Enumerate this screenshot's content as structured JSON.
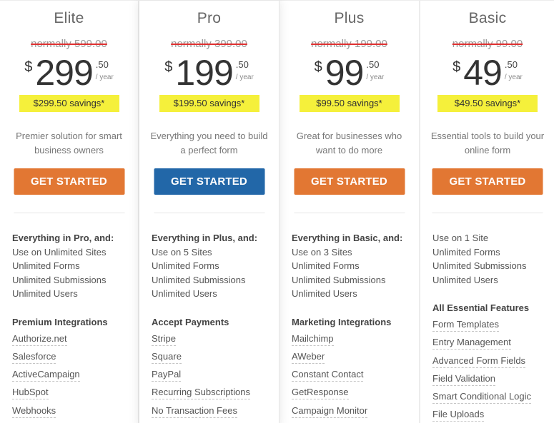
{
  "colors": {
    "orange_button": "#e27733",
    "blue_button": "#2267a8",
    "savings_highlight": "#f5f03b",
    "strike": "#e03030"
  },
  "plans": [
    {
      "name": "Elite",
      "normal_price": "normally 599.00",
      "currency": "$",
      "amount": "299",
      "cents": ".50",
      "period": "/ year",
      "savings": "$299.50 savings*",
      "description": "Premier solution for smart business owners",
      "cta": "GET STARTED",
      "cta_style": "orange",
      "featured": false,
      "features_heading": "Everything in Pro, and:",
      "features": [
        "Use on Unlimited Sites",
        "Unlimited Forms",
        "Unlimited Submissions",
        "Unlimited Users"
      ],
      "group_heading": "Premium Integrations",
      "group_items": [
        "Authorize.net",
        "Salesforce",
        "ActiveCampaign",
        "HubSpot",
        "Webhooks"
      ]
    },
    {
      "name": "Pro",
      "normal_price": "normally 399.00",
      "currency": "$",
      "amount": "199",
      "cents": ".50",
      "period": "/ year",
      "savings": "$199.50 savings*",
      "description": "Everything you need to build a perfect form",
      "cta": "GET STARTED",
      "cta_style": "blue",
      "featured": true,
      "features_heading": "Everything in Plus, and:",
      "features": [
        "Use on 5 Sites",
        "Unlimited Forms",
        "Unlimited Submissions",
        "Unlimited Users"
      ],
      "group_heading": "Accept Payments",
      "group_items": [
        "Stripe",
        "Square",
        "PayPal",
        "Recurring Subscriptions",
        "No Transaction Fees"
      ]
    },
    {
      "name": "Plus",
      "normal_price": "normally 199.00",
      "currency": "$",
      "amount": "99",
      "cents": ".50",
      "period": "/ year",
      "savings": "$99.50 savings*",
      "description": "Great for businesses who want to do more",
      "cta": "GET STARTED",
      "cta_style": "orange",
      "featured": false,
      "features_heading": "Everything in Basic, and:",
      "features": [
        "Use on 3 Sites",
        "Unlimited Forms",
        "Unlimited Submissions",
        "Unlimited Users"
      ],
      "group_heading": "Marketing Integrations",
      "group_items": [
        "Mailchimp",
        "AWeber",
        "Constant Contact",
        "GetResponse",
        "Campaign Monitor"
      ]
    },
    {
      "name": "Basic",
      "normal_price": "normally 99.00",
      "currency": "$",
      "amount": "49",
      "cents": ".50",
      "period": "/ year",
      "savings": "$49.50 savings*",
      "description": "Essential tools to build your online form",
      "cta": "GET STARTED",
      "cta_style": "orange",
      "featured": false,
      "features_heading": "",
      "features": [
        "Use on 1 Site",
        "Unlimited Forms",
        "Unlimited Submissions",
        "Unlimited Users"
      ],
      "group_heading": "All Essential Features",
      "group_items": [
        "Form Templates",
        "Entry Management",
        "Advanced Form Fields",
        "Field Validation",
        "Smart Conditional Logic",
        "File Uploads"
      ]
    }
  ]
}
